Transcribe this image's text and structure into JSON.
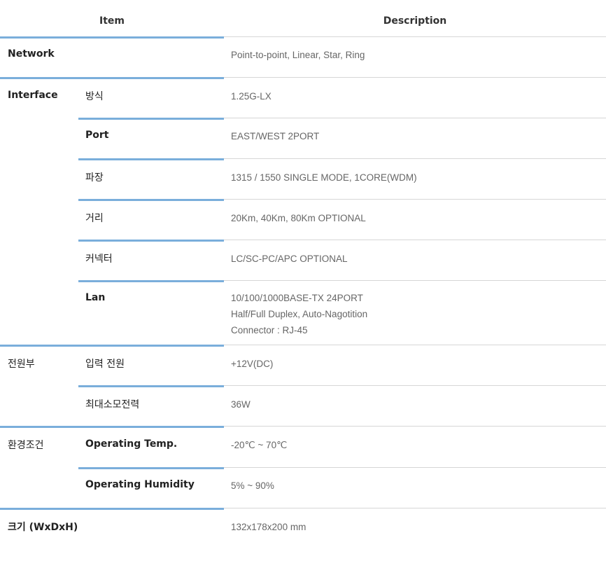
{
  "header": {
    "item": "Item",
    "description": "Description"
  },
  "rows": [
    {
      "group": "Network",
      "sub": "",
      "desc": [
        "Point-to-point, Linear, Star, Ring"
      ]
    },
    {
      "group": "Interface",
      "sub": "방식",
      "desc": [
        "1.25G-LX"
      ]
    },
    {
      "group": "",
      "sub": "Port",
      "desc": [
        "EAST/WEST 2PORT"
      ]
    },
    {
      "group": "",
      "sub": "파장",
      "desc": [
        "1315 / 1550 SINGLE MODE, 1CORE(WDM)"
      ]
    },
    {
      "group": "",
      "sub": "거리",
      "desc": [
        "20Km, 40Km, 80Km OPTIONAL"
      ]
    },
    {
      "group": "",
      "sub": "커넥터",
      "desc": [
        "LC/SC-PC/APC OPTIONAL"
      ]
    },
    {
      "group": "",
      "sub": "Lan",
      "desc": [
        "10/100/1000BASE-TX 24PORT",
        "Half/Full Duplex, Auto-Nagotition",
        "Connector : RJ-45"
      ]
    },
    {
      "group": "전원부",
      "sub": "입력 전원",
      "desc": [
        "+12V(DC)"
      ]
    },
    {
      "group": "",
      "sub": "최대소모전력",
      "desc": [
        "36W"
      ]
    },
    {
      "group": "환경조건",
      "sub": "Operating Temp.",
      "desc": [
        "-20℃ ~ 70℃"
      ]
    },
    {
      "group": "",
      "sub": "Operating Humidity",
      "desc": [
        "5% ~ 90%"
      ]
    },
    {
      "group": "크기 (WxDxH)",
      "sub": "",
      "desc": [
        "132x178x200 mm"
      ]
    }
  ]
}
